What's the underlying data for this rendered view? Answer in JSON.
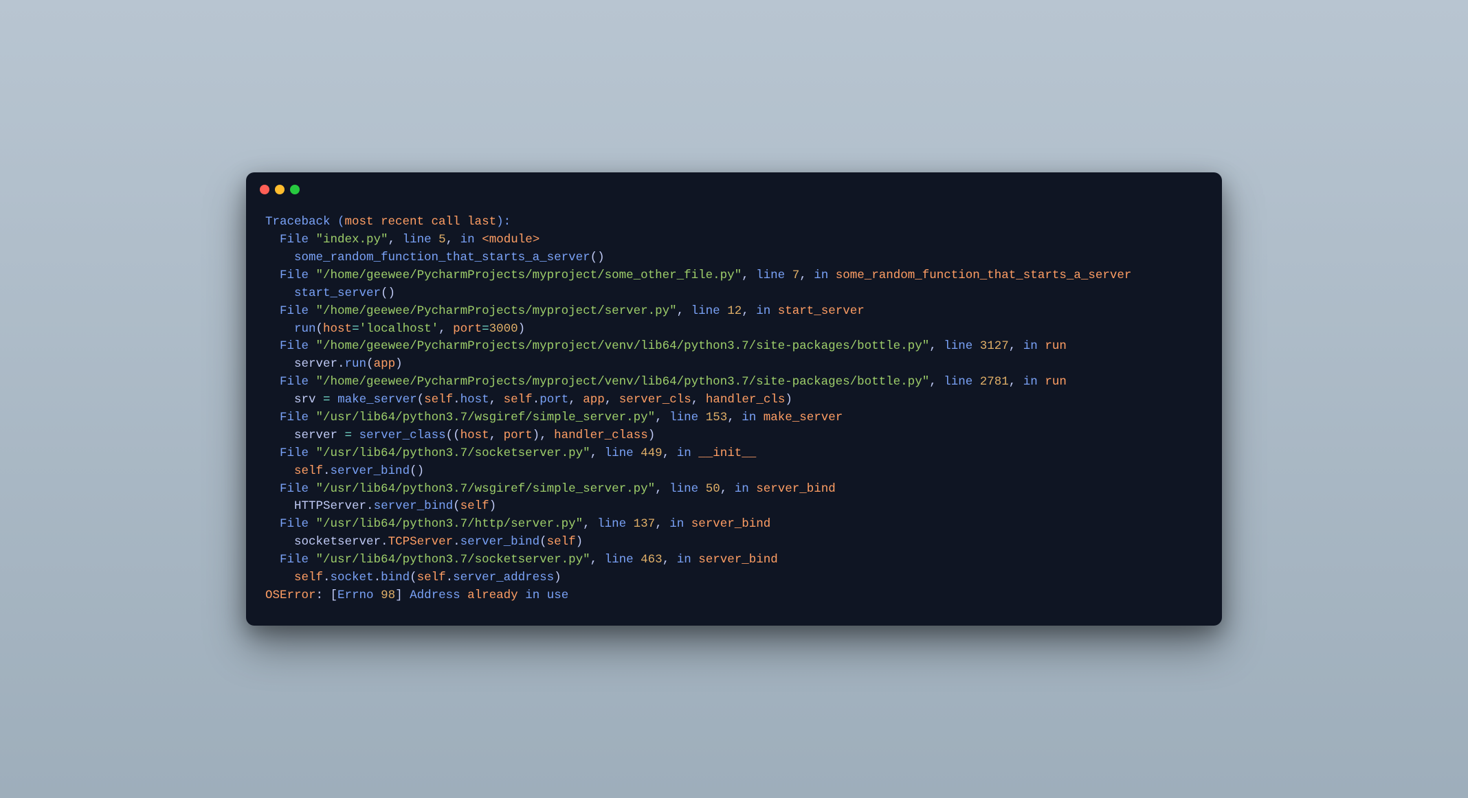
{
  "traceback": {
    "header_prefix": "Traceback (",
    "header_middle": "most recent call last",
    "header_suffix": "):",
    "file_word": "File",
    "line_word": "line",
    "in_word": "in",
    "frames": [
      {
        "file": "index.py",
        "line": "5",
        "func": "<module>",
        "code_tokens": [
          {
            "t": "some_random_function_that_starts_a_server",
            "c": "blue"
          },
          {
            "t": "()",
            "c": "white"
          }
        ]
      },
      {
        "file": "/home/geewee/PycharmProjects/myproject/some_other_file.py",
        "line": "7",
        "func": "some_random_function_that_starts_a_server",
        "code_tokens": [
          {
            "t": "start_server",
            "c": "blue"
          },
          {
            "t": "()",
            "c": "white"
          }
        ]
      },
      {
        "file": "/home/geewee/PycharmProjects/myproject/server.py",
        "line": "12",
        "func": "start_server",
        "code_tokens": [
          {
            "t": "run",
            "c": "blue"
          },
          {
            "t": "(",
            "c": "white"
          },
          {
            "t": "host",
            "c": "orange"
          },
          {
            "t": "=",
            "c": "teal"
          },
          {
            "t": "'localhost'",
            "c": "green"
          },
          {
            "t": ", ",
            "c": "white"
          },
          {
            "t": "port",
            "c": "orange"
          },
          {
            "t": "=",
            "c": "teal"
          },
          {
            "t": "3000",
            "c": "yellow"
          },
          {
            "t": ")",
            "c": "white"
          }
        ]
      },
      {
        "file": "/home/geewee/PycharmProjects/myproject/venv/lib64/python3.7/site-packages/bottle.py",
        "line": "3127",
        "func": "run",
        "code_tokens": [
          {
            "t": "server",
            "c": "white"
          },
          {
            "t": ".",
            "c": "white"
          },
          {
            "t": "run",
            "c": "blue"
          },
          {
            "t": "(",
            "c": "white"
          },
          {
            "t": "app",
            "c": "orange"
          },
          {
            "t": ")",
            "c": "white"
          }
        ]
      },
      {
        "file": "/home/geewee/PycharmProjects/myproject/venv/lib64/python3.7/site-packages/bottle.py",
        "line": "2781",
        "func": "run",
        "code_tokens": [
          {
            "t": "srv ",
            "c": "white"
          },
          {
            "t": "=",
            "c": "teal"
          },
          {
            "t": " ",
            "c": "white"
          },
          {
            "t": "make_server",
            "c": "blue"
          },
          {
            "t": "(",
            "c": "white"
          },
          {
            "t": "self",
            "c": "orange"
          },
          {
            "t": ".",
            "c": "white"
          },
          {
            "t": "host",
            "c": "blue"
          },
          {
            "t": ", ",
            "c": "white"
          },
          {
            "t": "self",
            "c": "orange"
          },
          {
            "t": ".",
            "c": "white"
          },
          {
            "t": "port",
            "c": "blue"
          },
          {
            "t": ", ",
            "c": "white"
          },
          {
            "t": "app",
            "c": "orange"
          },
          {
            "t": ", ",
            "c": "white"
          },
          {
            "t": "server_cls",
            "c": "orange"
          },
          {
            "t": ", ",
            "c": "white"
          },
          {
            "t": "handler_cls",
            "c": "orange"
          },
          {
            "t": ")",
            "c": "white"
          }
        ]
      },
      {
        "file": "/usr/lib64/python3.7/wsgiref/simple_server.py",
        "line": "153",
        "func": "make_server",
        "code_tokens": [
          {
            "t": "server ",
            "c": "white"
          },
          {
            "t": "=",
            "c": "teal"
          },
          {
            "t": " ",
            "c": "white"
          },
          {
            "t": "server_class",
            "c": "blue"
          },
          {
            "t": "((",
            "c": "white"
          },
          {
            "t": "host",
            "c": "orange"
          },
          {
            "t": ", ",
            "c": "white"
          },
          {
            "t": "port",
            "c": "orange"
          },
          {
            "t": "), ",
            "c": "white"
          },
          {
            "t": "handler_class",
            "c": "orange"
          },
          {
            "t": ")",
            "c": "white"
          }
        ]
      },
      {
        "file": "/usr/lib64/python3.7/socketserver.py",
        "line": "449",
        "func": "__init__",
        "code_tokens": [
          {
            "t": "self",
            "c": "orange"
          },
          {
            "t": ".",
            "c": "white"
          },
          {
            "t": "server_bind",
            "c": "blue"
          },
          {
            "t": "()",
            "c": "white"
          }
        ]
      },
      {
        "file": "/usr/lib64/python3.7/wsgiref/simple_server.py",
        "line": "50",
        "func": "server_bind",
        "code_tokens": [
          {
            "t": "HTTPServer",
            "c": "white"
          },
          {
            "t": ".",
            "c": "white"
          },
          {
            "t": "server_bind",
            "c": "blue"
          },
          {
            "t": "(",
            "c": "white"
          },
          {
            "t": "self",
            "c": "orange"
          },
          {
            "t": ")",
            "c": "white"
          }
        ]
      },
      {
        "file": "/usr/lib64/python3.7/http/server.py",
        "line": "137",
        "func": "server_bind",
        "code_tokens": [
          {
            "t": "socketserver",
            "c": "white"
          },
          {
            "t": ".",
            "c": "white"
          },
          {
            "t": "TCPServer",
            "c": "orange"
          },
          {
            "t": ".",
            "c": "white"
          },
          {
            "t": "server_bind",
            "c": "blue"
          },
          {
            "t": "(",
            "c": "white"
          },
          {
            "t": "self",
            "c": "orange"
          },
          {
            "t": ")",
            "c": "white"
          }
        ]
      },
      {
        "file": "/usr/lib64/python3.7/socketserver.py",
        "line": "463",
        "func": "server_bind",
        "code_tokens": [
          {
            "t": "self",
            "c": "orange"
          },
          {
            "t": ".",
            "c": "white"
          },
          {
            "t": "socket",
            "c": "blue"
          },
          {
            "t": ".",
            "c": "white"
          },
          {
            "t": "bind",
            "c": "blue"
          },
          {
            "t": "(",
            "c": "white"
          },
          {
            "t": "self",
            "c": "orange"
          },
          {
            "t": ".",
            "c": "white"
          },
          {
            "t": "server_address",
            "c": "blue"
          },
          {
            "t": ")",
            "c": "white"
          }
        ]
      }
    ],
    "error": {
      "type": "OSError",
      "bracket_open": "[",
      "errno_word": "Errno",
      "errno_num": "98",
      "bracket_close": "]",
      "msg_word1": "Address",
      "msg_word2": "already",
      "msg_word3": "in",
      "msg_word4": "use"
    }
  }
}
